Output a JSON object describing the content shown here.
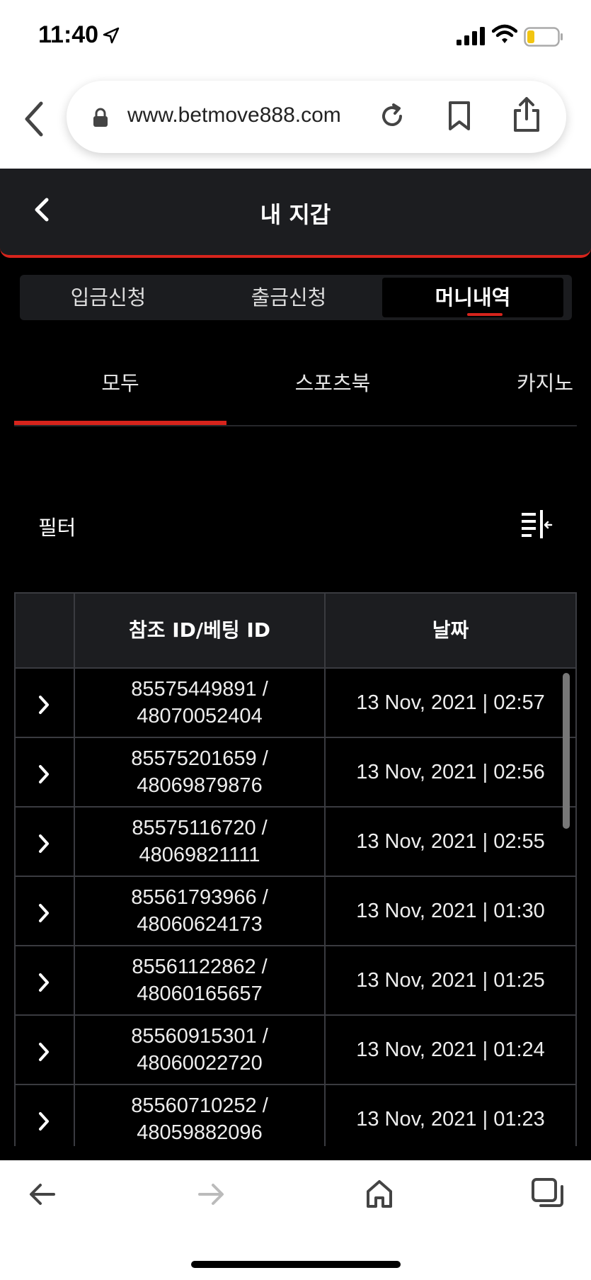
{
  "status": {
    "time": "11:40"
  },
  "browser": {
    "url": "www.betmove888.com"
  },
  "header": {
    "title": "내 지갑"
  },
  "segment": {
    "deposit": "입금신청",
    "withdraw": "출금신청",
    "history": "머니내역"
  },
  "categories": {
    "all": "모두",
    "sports": "스포츠북",
    "casino": "카지노"
  },
  "filter": {
    "label": "필터"
  },
  "table": {
    "columns": {
      "ref": "참조 ID/베팅 ID",
      "date": "날짜"
    },
    "rows": [
      {
        "ref": "85575449891 /",
        "bet": "48070052404",
        "date": "13 Nov, 2021 | 02:57"
      },
      {
        "ref": "85575201659 /",
        "bet": "48069879876",
        "date": "13 Nov, 2021 | 02:56"
      },
      {
        "ref": "85575116720 /",
        "bet": "48069821111",
        "date": "13 Nov, 2021 | 02:55"
      },
      {
        "ref": "85561793966 /",
        "bet": "48060624173",
        "date": "13 Nov, 2021 | 01:30"
      },
      {
        "ref": "85561122862 /",
        "bet": "48060165657",
        "date": "13 Nov, 2021 | 01:25"
      },
      {
        "ref": "85560915301 /",
        "bet": "48060022720",
        "date": "13 Nov, 2021 | 01:24"
      },
      {
        "ref": "85560710252 /",
        "bet": "48059882096",
        "date": "13 Nov, 2021 | 01:23"
      }
    ]
  },
  "colors": {
    "accent": "#d6241c",
    "background": "#000000",
    "panel": "#1c1d20"
  }
}
